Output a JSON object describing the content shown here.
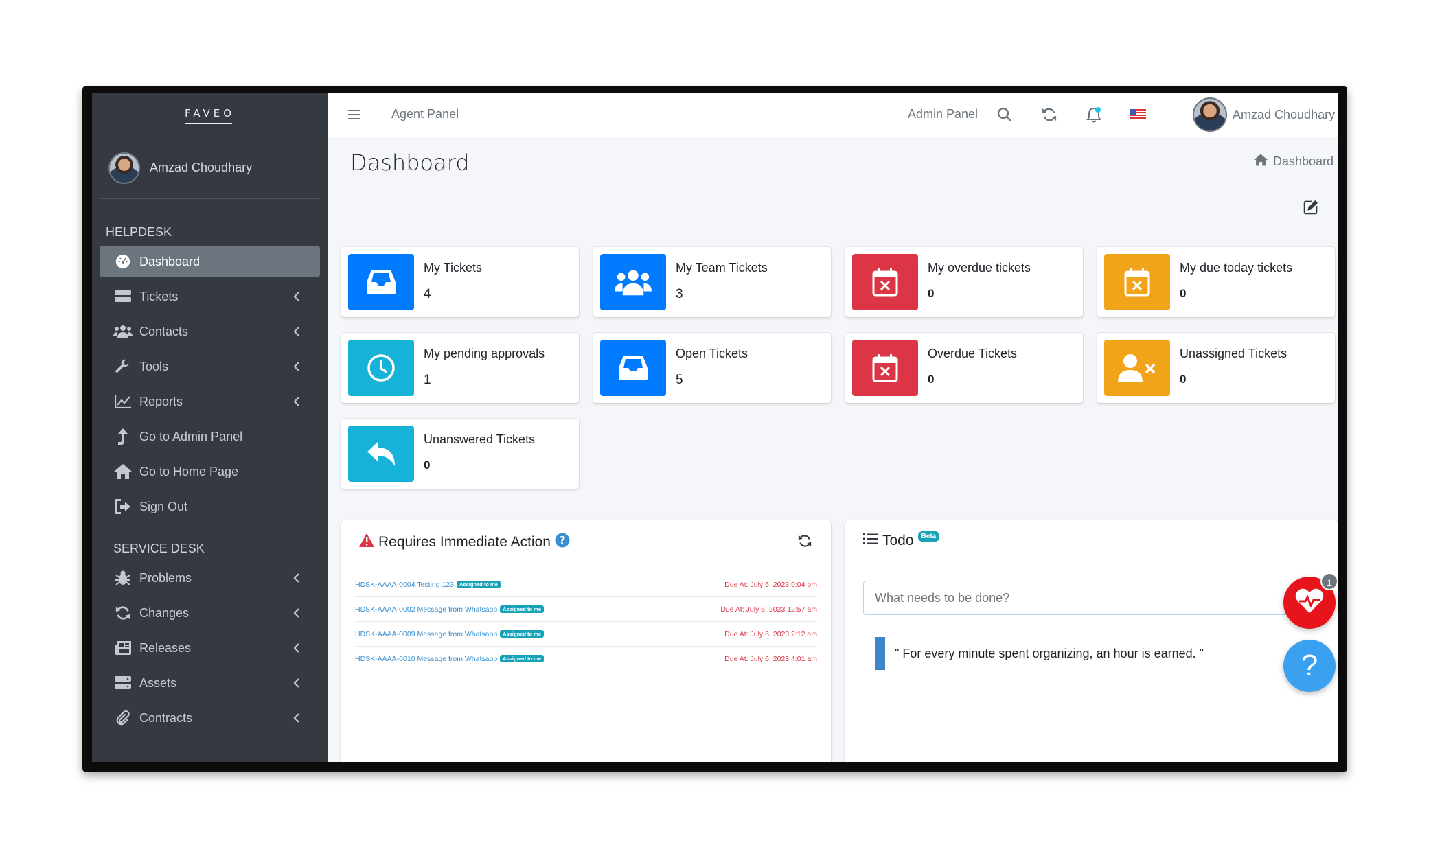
{
  "brand": {
    "logo": "FAVEO"
  },
  "user": {
    "name": "Amzad Choudhary"
  },
  "sidebar": {
    "helpdesk_header": "HELPDESK",
    "helpdesk_items": [
      {
        "label": "Dashboard",
        "icon": "dashboard-icon",
        "active": true
      },
      {
        "label": "Tickets",
        "icon": "ticket-icon"
      },
      {
        "label": "Contacts",
        "icon": "users-icon"
      },
      {
        "label": "Tools",
        "icon": "wrench-icon"
      },
      {
        "label": "Reports",
        "icon": "chart-icon"
      },
      {
        "label": "Go to Admin Panel",
        "icon": "level-up-icon"
      },
      {
        "label": "Go to Home Page",
        "icon": "home-icon"
      },
      {
        "label": "Sign Out",
        "icon": "sign-out-icon"
      }
    ],
    "servicedesk_header": "SERVICE DESK",
    "servicedesk_items": [
      {
        "label": "Problems",
        "icon": "bug-icon"
      },
      {
        "label": "Changes",
        "icon": "refresh-icon"
      },
      {
        "label": "Releases",
        "icon": "newspaper-icon"
      },
      {
        "label": "Assets",
        "icon": "server-icon"
      },
      {
        "label": "Contracts",
        "icon": "paperclip-icon"
      }
    ]
  },
  "topbar": {
    "agent_panel": "Agent Panel",
    "admin_panel": "Admin Panel",
    "user_name": "Amzad Choudhary"
  },
  "page": {
    "title": "Dashboard",
    "breadcrumb": "Dashboard"
  },
  "stats": [
    {
      "label": "My Tickets",
      "value": "4",
      "color": "#007bff",
      "icon": "inbox-icon"
    },
    {
      "label": "My Team Tickets",
      "value": "3",
      "color": "#007bff",
      "icon": "users-icon"
    },
    {
      "label": "My overdue tickets",
      "value": "0",
      "color": "#dc3545",
      "icon": "calendar-x-icon"
    },
    {
      "label": "My due today tickets",
      "value": "0",
      "color": "#f1a31a",
      "icon": "calendar-x-icon"
    },
    {
      "label": "My pending approvals",
      "value": "1",
      "color": "#17b2d8",
      "icon": "clock-icon"
    },
    {
      "label": "Open Tickets",
      "value": "5",
      "color": "#007bff",
      "icon": "inbox-icon"
    },
    {
      "label": "Overdue Tickets",
      "value": "0",
      "color": "#dc3545",
      "icon": "calendar-x-icon"
    },
    {
      "label": "Unassigned Tickets",
      "value": "0",
      "color": "#f1a31a",
      "icon": "user-times-icon"
    },
    {
      "label": "Unanswered Tickets",
      "value": "0",
      "color": "#17b2d8",
      "icon": "reply-icon"
    }
  ],
  "immediate_action": {
    "title": "Requires Immediate Action",
    "rows": [
      {
        "ticket": "HDSK-AAAA-0004 Testing 123",
        "badge": "Assigned to me",
        "due": "Due At: July 5, 2023 9:04 pm"
      },
      {
        "ticket": "HDSK-AAAA-0002 Message from Whatsapp",
        "badge": "Assigned to me",
        "due": "Due At: July 6, 2023 12:57 am"
      },
      {
        "ticket": "HDSK-AAAA-0009 Message from Whatsapp",
        "badge": "Assigned to me",
        "due": "Due At: July 6, 2023 2:12 am"
      },
      {
        "ticket": "HDSK-AAAA-0010 Message from Whatsapp",
        "badge": "Assigned to me",
        "due": "Due At: July 6, 2023 4:01 am"
      }
    ]
  },
  "todo": {
    "title": "Todo",
    "badge": "Beta",
    "placeholder": "What needs to be done?",
    "quote": "\" For every minute spent organizing, an hour is earned. \""
  },
  "floating": {
    "health_count": "1",
    "help_label": "?"
  }
}
